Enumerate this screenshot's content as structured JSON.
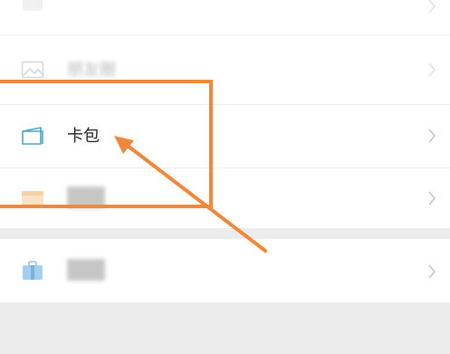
{
  "menu": {
    "items": [
      {
        "label": "",
        "icon": "menu-item-icon",
        "obscured": true
      },
      {
        "label": "朋友圈",
        "icon": "moments-photo-icon",
        "obscured": true
      },
      {
        "label": "卡包",
        "icon": "card-wallet-icon",
        "obscured": false
      },
      {
        "label": "",
        "icon": "menu-item-icon",
        "obscured": true
      },
      {
        "label": "",
        "icon": "bag-icon",
        "obscured": true
      }
    ]
  },
  "annotation": {
    "highlight_target": "卡包",
    "color": "#f0883c"
  },
  "colors": {
    "page_background": "#ffffff",
    "section_gap": "#ececec",
    "divider": "#ededed",
    "card_icon": "#4aa3c8",
    "chevron": "#c4c4c4"
  }
}
